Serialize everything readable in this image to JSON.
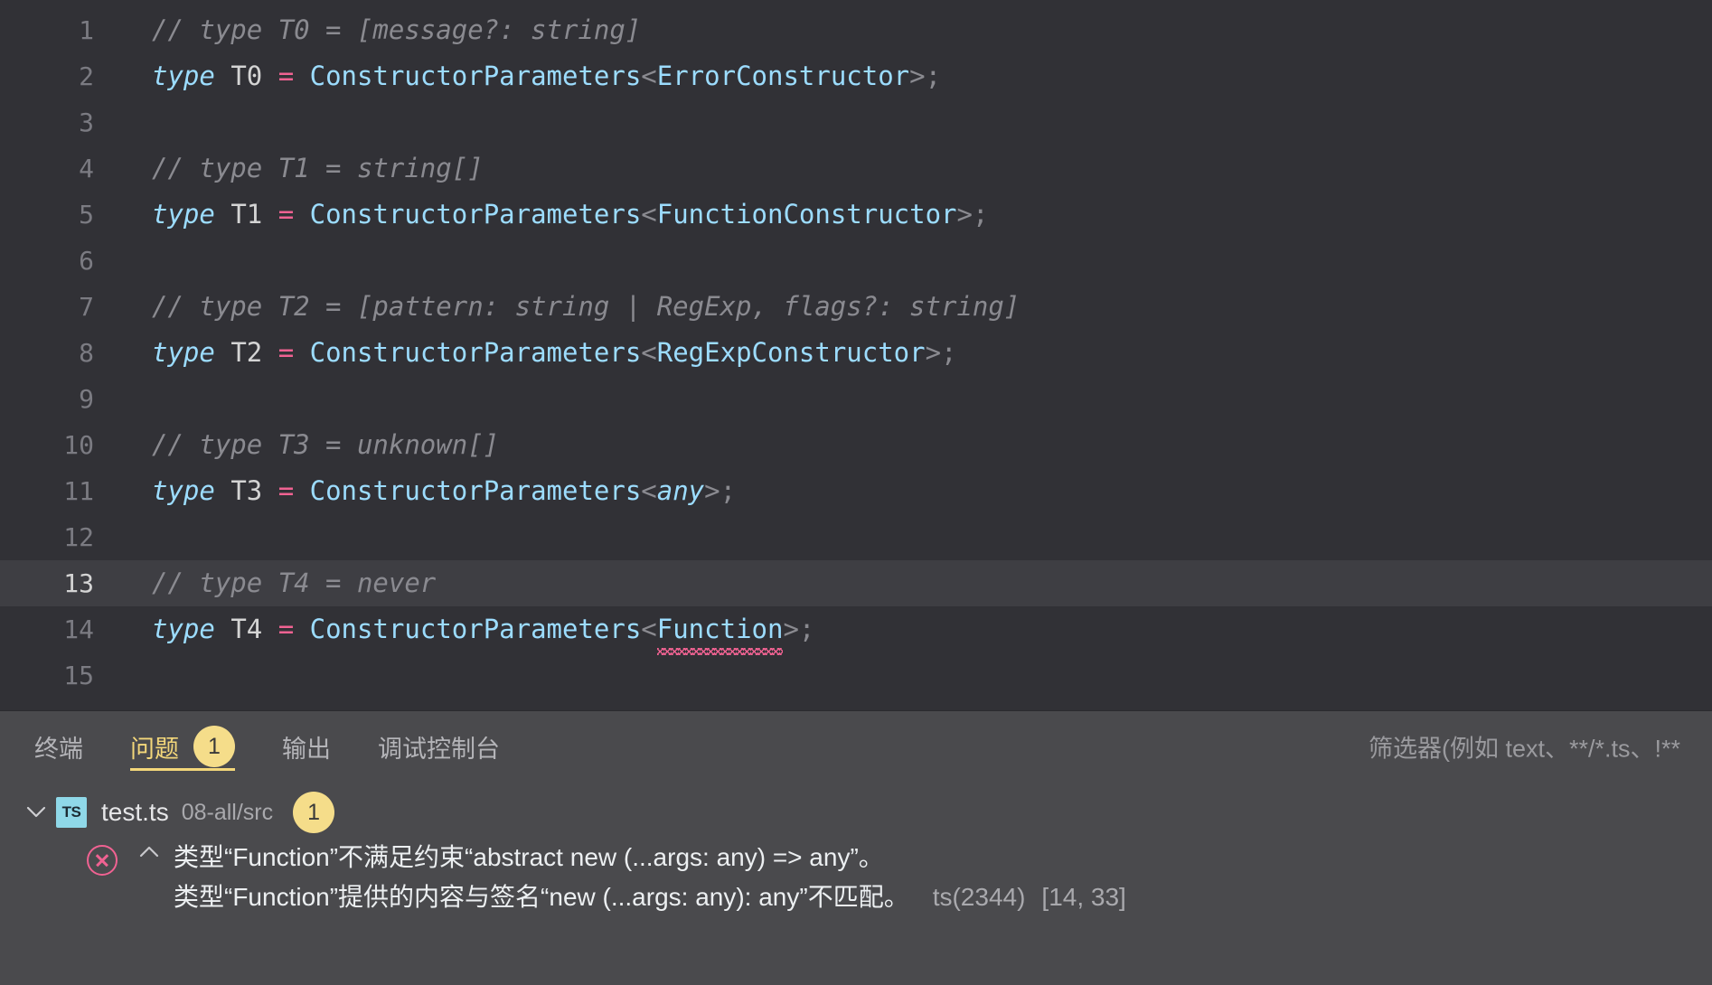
{
  "editor": {
    "language": "typescript",
    "active_line": 13,
    "lines": [
      {
        "num": 1,
        "kind": "comment",
        "text": "// type T0 = [message?: string]"
      },
      {
        "num": 2,
        "kind": "code",
        "keyword": "type",
        "name": "T0",
        "op": "=",
        "generic": "ConstructorParameters",
        "param": "ErrorConstructor",
        "tail": ";"
      },
      {
        "num": 3,
        "kind": "blank",
        "text": ""
      },
      {
        "num": 4,
        "kind": "comment",
        "text": "// type T1 = string[]"
      },
      {
        "num": 5,
        "kind": "code",
        "keyword": "type",
        "name": "T1",
        "op": "=",
        "generic": "ConstructorParameters",
        "param": "FunctionConstructor",
        "tail": ";"
      },
      {
        "num": 6,
        "kind": "blank",
        "text": ""
      },
      {
        "num": 7,
        "kind": "comment",
        "text": "// type T2 = [pattern: string | RegExp, flags?: string]"
      },
      {
        "num": 8,
        "kind": "code",
        "keyword": "type",
        "name": "T2",
        "op": "=",
        "generic": "ConstructorParameters",
        "param": "RegExpConstructor",
        "tail": ";"
      },
      {
        "num": 9,
        "kind": "blank",
        "text": ""
      },
      {
        "num": 10,
        "kind": "comment",
        "text": "// type T3 = unknown[]"
      },
      {
        "num": 11,
        "kind": "code",
        "keyword": "type",
        "name": "T3",
        "op": "=",
        "generic": "ConstructorParameters",
        "param": "any",
        "param_italic": true,
        "tail": ";"
      },
      {
        "num": 12,
        "kind": "blank",
        "text": ""
      },
      {
        "num": 13,
        "kind": "comment",
        "text": "// type T4 = never",
        "active": true
      },
      {
        "num": 14,
        "kind": "code",
        "keyword": "type",
        "name": "T4",
        "op": "=",
        "generic": "ConstructorParameters",
        "param": "Function",
        "param_error": true,
        "tail": ";"
      },
      {
        "num": 15,
        "kind": "blank",
        "text": ""
      }
    ]
  },
  "panel": {
    "tabs": [
      {
        "id": "terminal",
        "label": "终端",
        "active": false,
        "badge": null
      },
      {
        "id": "problems",
        "label": "问题",
        "active": true,
        "badge": "1"
      },
      {
        "id": "output",
        "label": "输出",
        "active": false,
        "badge": null
      },
      {
        "id": "debug-console",
        "label": "调试控制台",
        "active": false,
        "badge": null
      }
    ],
    "filter": {
      "value": "",
      "placeholder": "筛选器(例如 text、**/*.ts、!**"
    },
    "problems": {
      "files": [
        {
          "name": "test.ts",
          "path": "08-all/src",
          "badge": "1",
          "expanded": true,
          "icon": "typescript-file-icon",
          "icon_label": "TS",
          "items": [
            {
              "severity": "error",
              "message_line_1": "类型“Function”不满足约束“abstract new (...args: any) => any”。",
              "message_line_2": "类型“Function”提供的内容与签名“new (...args: any): any”不匹配。",
              "code": "ts(2344)",
              "position": "[14, 33]"
            }
          ]
        }
      ]
    }
  },
  "colors": {
    "editor_bg": "#313136",
    "active_line_bg": "#3e3e43",
    "panel_bg": "#4a4a4d",
    "accent_yellow": "#f3d77a",
    "error_pink": "#f06292",
    "type_blue": "#9cdcfe",
    "comment_gray": "#8a8a90"
  }
}
